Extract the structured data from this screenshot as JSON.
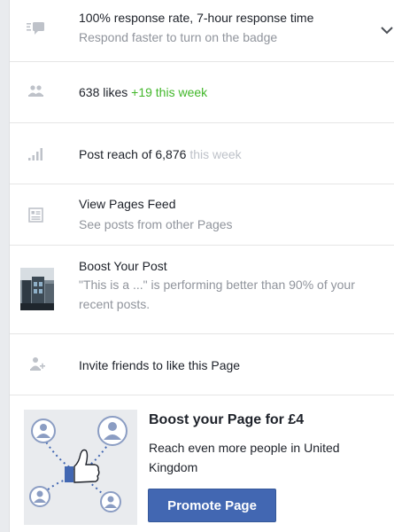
{
  "response": {
    "title": "100% response rate, 7-hour response time",
    "subtitle": "Respond faster to turn on the badge",
    "icon": "message-icon"
  },
  "likes": {
    "count_text": "638 likes",
    "delta_text": "+19 this week",
    "icon": "people-icon"
  },
  "reach": {
    "main_text": "Post reach of 6,876",
    "period_text": "this week",
    "icon": "bar-chart-icon"
  },
  "pages_feed": {
    "title": "View Pages Feed",
    "subtitle": "See posts from other Pages",
    "icon": "feed-icon"
  },
  "boost_post": {
    "title": "Boost Your Post",
    "description": "\"This is a ...\" is performing better than 90% of your recent posts."
  },
  "invite": {
    "text": "Invite friends to like this Page",
    "icon": "add-person-icon"
  },
  "promo": {
    "title": "Boost your Page for £4",
    "description": "Reach even more people in United Kingdom",
    "button_label": "Promote Page"
  },
  "colors": {
    "accent_green": "#42b72a",
    "button_blue": "#4267b2",
    "icon_grey": "#bec2c9",
    "sub_text": "#90949c"
  }
}
